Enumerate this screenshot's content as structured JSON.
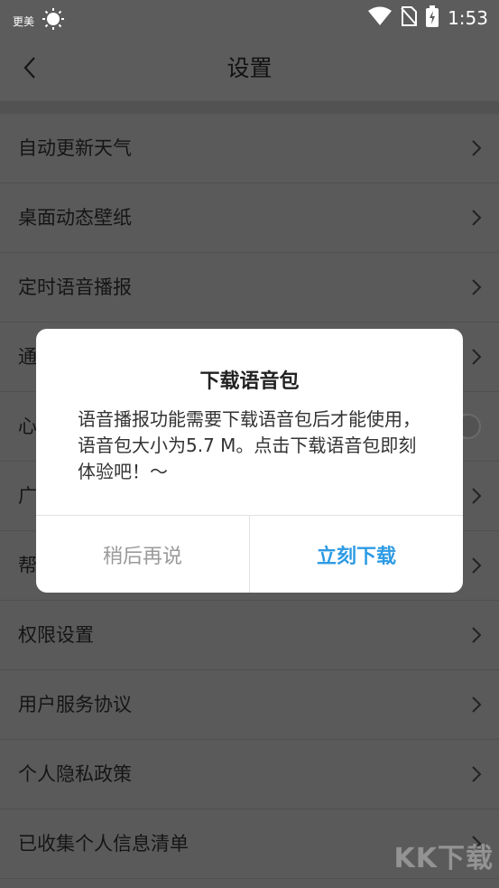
{
  "status_bar": {
    "carrier": "更美",
    "time": "1:53"
  },
  "header": {
    "title": "设置"
  },
  "settings": {
    "items": [
      {
        "label": "自动更新天气",
        "control": "chevron"
      },
      {
        "label": "桌面动态壁纸",
        "control": "chevron"
      },
      {
        "label": "定时语音播报",
        "control": "chevron"
      },
      {
        "label": "通",
        "control": "chevron"
      },
      {
        "label": "心",
        "control": "toggle"
      },
      {
        "label": "广",
        "control": "chevron"
      },
      {
        "label": "帮",
        "control": "chevron"
      },
      {
        "label": "权限设置",
        "control": "chevron"
      },
      {
        "label": "用户服务协议",
        "control": "chevron"
      },
      {
        "label": "个人隐私政策",
        "control": "chevron"
      },
      {
        "label": "已收集个人信息清单",
        "control": "chevron"
      }
    ]
  },
  "dialog": {
    "title": "下载语音包",
    "message": "语音播报功能需要下载语音包后才能使用，语音包大小为5.7 M。点击下载语音包即刻体验吧！～",
    "cancel_label": "稍后再说",
    "confirm_label": "立刻下载"
  },
  "watermark": "KK下载",
  "colors": {
    "accent": "#2d9be4",
    "overlay": "#5a5a5a"
  }
}
